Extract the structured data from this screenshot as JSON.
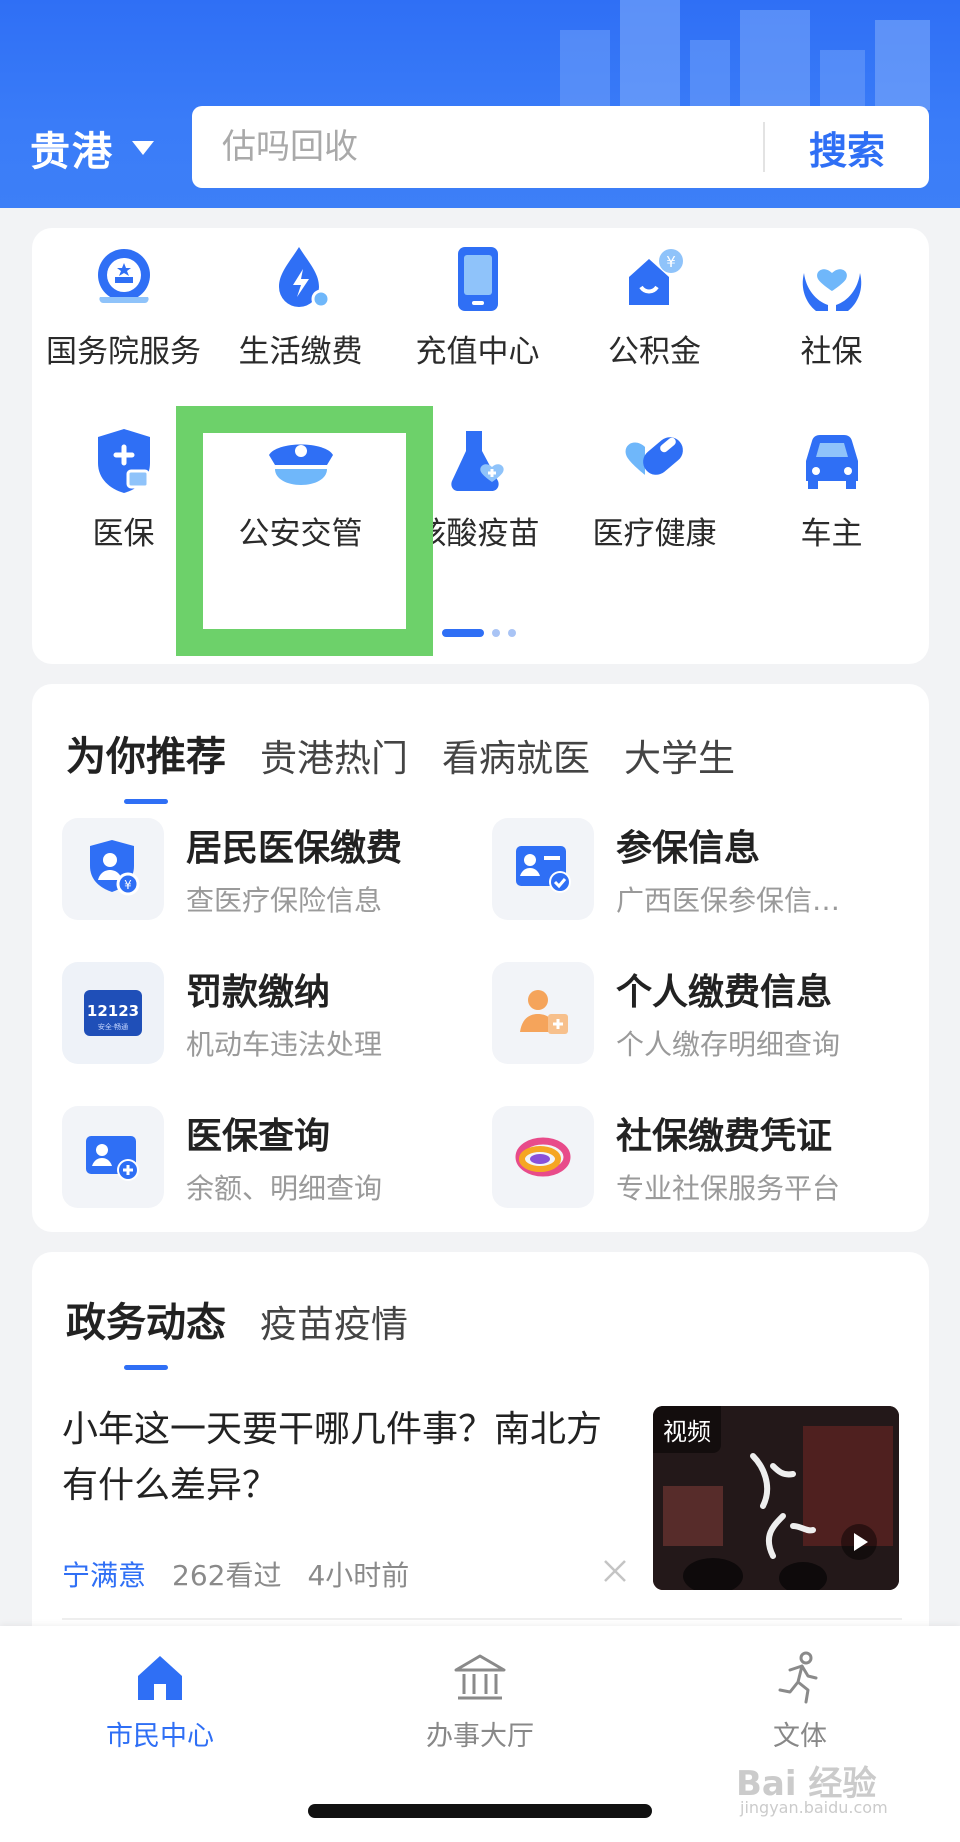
{
  "colors": {
    "brand": "#2f6ff5",
    "highlight": "#6dd16a",
    "background": "#f2f3f5"
  },
  "header": {
    "city": "贵港",
    "search": {
      "placeholder": "估吗回收",
      "button": "搜索"
    }
  },
  "services": [
    {
      "label": "国务院服务",
      "icon": "state-council-emblem-icon"
    },
    {
      "label": "生活缴费",
      "icon": "bill-payment-icon"
    },
    {
      "label": "充值中心",
      "icon": "phone-topup-icon"
    },
    {
      "label": "公积金",
      "icon": "housing-fund-icon"
    },
    {
      "label": "社保",
      "icon": "social-security-icon"
    },
    {
      "label": "医保",
      "icon": "medical-insurance-icon"
    },
    {
      "label": "公安交管",
      "icon": "police-cap-icon"
    },
    {
      "label": "核酸疫苗",
      "icon": "vaccine-flask-icon"
    },
    {
      "label": "医疗健康",
      "icon": "pill-heart-icon"
    },
    {
      "label": "车主",
      "icon": "car-icon"
    }
  ],
  "services_pager": {
    "pages": 3,
    "current": 1
  },
  "recommend": {
    "tabs": [
      "为你推荐",
      "贵港热门",
      "看病就医",
      "大学生"
    ],
    "active_tab": 0,
    "items": [
      {
        "title": "居民医保缴费",
        "subtitle": "查医疗保险信息",
        "icon": "insurance-payment-icon"
      },
      {
        "title": "参保信息",
        "subtitle": "广西医保参保信…",
        "icon": "id-card-check-icon"
      },
      {
        "title": "罚款缴纳",
        "subtitle": "机动车违法处理",
        "icon": "app-12123-icon",
        "icon_text": "12123",
        "icon_subtext": "安全·畅通"
      },
      {
        "title": "个人缴费信息",
        "subtitle": "个人缴存明细查询",
        "icon": "person-add-icon"
      },
      {
        "title": "医保查询",
        "subtitle": "余额、明细查询",
        "icon": "id-card-plus-icon"
      },
      {
        "title": "社保缴费凭证",
        "subtitle": "专业社保服务平台",
        "icon": "ring-logo-icon"
      }
    ]
  },
  "news": {
    "tabs": [
      "政务动态",
      "疫苗疫情"
    ],
    "active_tab": 0,
    "article": {
      "title": "小年这一天要干哪几件事？南北方有什么差异？",
      "source": "宁满意",
      "views": "262看过",
      "time": "4小时前",
      "thumb_tag": "视频"
    }
  },
  "bottom_nav": [
    {
      "label": "市民中心",
      "icon": "home-icon",
      "active": true
    },
    {
      "label": "办事大厅",
      "icon": "government-hall-icon",
      "active": false
    },
    {
      "label": "文体",
      "icon": "running-person-icon",
      "active": false
    }
  ],
  "watermark": {
    "text": "Bai 经验",
    "sub": "jingyan.baidu.com"
  }
}
